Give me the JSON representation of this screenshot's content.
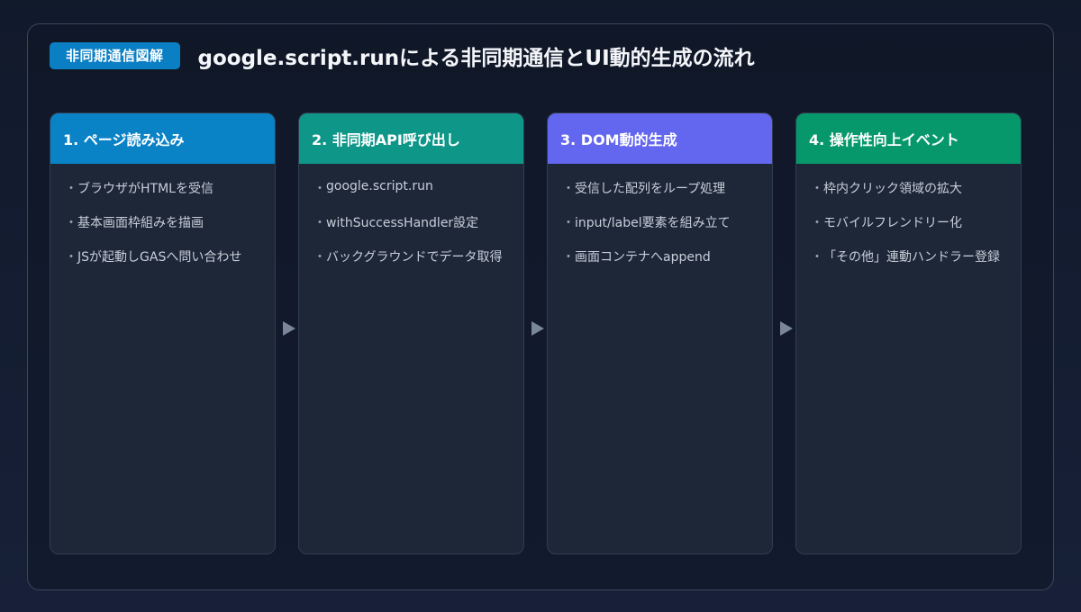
{
  "header": {
    "badge": "非同期通信図解",
    "title": "google.script.runによる非同期通信とUI動的生成の流れ"
  },
  "steps": [
    {
      "title": "1. ページ読み込み",
      "color": "#0a82c6",
      "items": [
        "ブラウザがHTMLを受信",
        "基本画面枠組みを描画",
        "JSが起動しGASへ問い合わせ"
      ]
    },
    {
      "title": "2. 非同期API呼び出し",
      "color": "#0e9688",
      "items": [
        "google.script.run",
        "withSuccessHandler設定",
        "バックグラウンドでデータ取得"
      ]
    },
    {
      "title": "3. DOM動的生成",
      "color": "#6366ef",
      "items": [
        "受信した配列をループ処理",
        "input/label要素を組み立て",
        "画面コンテナへappend"
      ]
    },
    {
      "title": "4. 操作性向上イベント",
      "color": "#06986a",
      "items": [
        "枠内クリック領域の拡大",
        "モバイルフレンドリー化",
        "「その他」連動ハンドラー登録"
      ]
    }
  ],
  "bullet": "・",
  "arrow_icon": "right-triangle-arrow"
}
